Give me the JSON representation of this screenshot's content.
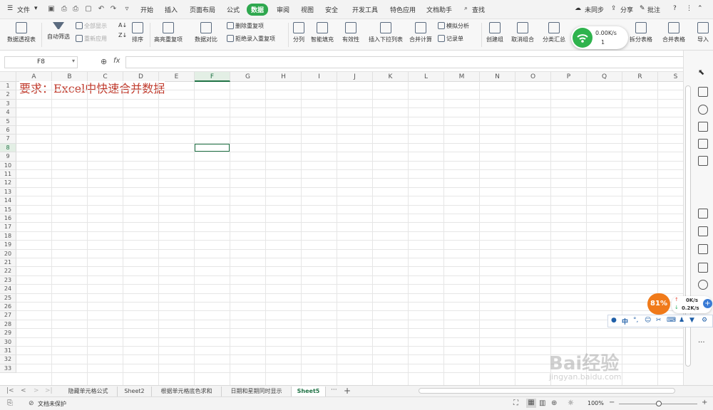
{
  "menubar": {
    "file_label": "文件",
    "items": [
      "开始",
      "插入",
      "页面布局",
      "公式",
      "数据",
      "审阅",
      "视图",
      "安全",
      "开发工具",
      "特色应用",
      "文档助手"
    ],
    "active": "数据",
    "search": "查找",
    "sync": "未同步",
    "share": "分享",
    "comment": "批注"
  },
  "ribbon": {
    "pivot": "数据透视表",
    "autofilter": "自动筛选",
    "show_all": "全部显示",
    "reapply": "重新应用",
    "sort": "排序",
    "highlight_dup": "高亮重复项",
    "compare": "数据对比",
    "remove_dup": "删除重复项",
    "reject_dup": "拒绝录入重复项",
    "split": "分列",
    "smart_fill": "智能填充",
    "validity": "有效性",
    "insert_dropdown": "插入下拉列表",
    "consolidate": "合并计算",
    "what_if": "模拟分析",
    "record": "记录单",
    "group": "创建组",
    "ungroup": "取消组合",
    "subtotal": "分类汇总",
    "split_table": "拆分表格",
    "merge_table": "合并表格",
    "import": "导入"
  },
  "net_widget": {
    "speed": "0.00K/s",
    "count": "1"
  },
  "formula_bar": {
    "cell_ref": "F8",
    "fx": "fx",
    "formula": ""
  },
  "grid": {
    "columns": [
      "A",
      "B",
      "C",
      "D",
      "E",
      "F",
      "G",
      "H",
      "I",
      "J",
      "K",
      "L",
      "M",
      "N",
      "O",
      "P",
      "Q",
      "R",
      "S"
    ],
    "rows": [
      "1",
      "2",
      "3",
      "4",
      "5",
      "6",
      "7",
      "8",
      "9",
      "10",
      "11",
      "12",
      "13",
      "14",
      "15",
      "16",
      "17",
      "18",
      "19",
      "20",
      "21",
      "22",
      "23",
      "24",
      "25",
      "26",
      "27",
      "28",
      "29",
      "30",
      "31",
      "32",
      "33"
    ],
    "selected_col": "F",
    "selected_row": "8",
    "cell_a1": "要求：Excel中快速合并数据"
  },
  "speed_widget": {
    "percent": "81%",
    "up": "0K/s",
    "down": "0.2K/s"
  },
  "ime": {
    "lang": "中"
  },
  "sheets": {
    "tabs": [
      "隐藏单元格公式",
      "Sheet2",
      "根据单元格底色求和",
      "日期和星期同时显示",
      "Sheet5"
    ],
    "active": "Sheet5",
    "more": "···",
    "add": "+"
  },
  "status": {
    "protect": "文档未保护",
    "zoom": "100%"
  },
  "watermark": {
    "brand": "Bai经验",
    "url": "jingyan.baidu.com"
  }
}
